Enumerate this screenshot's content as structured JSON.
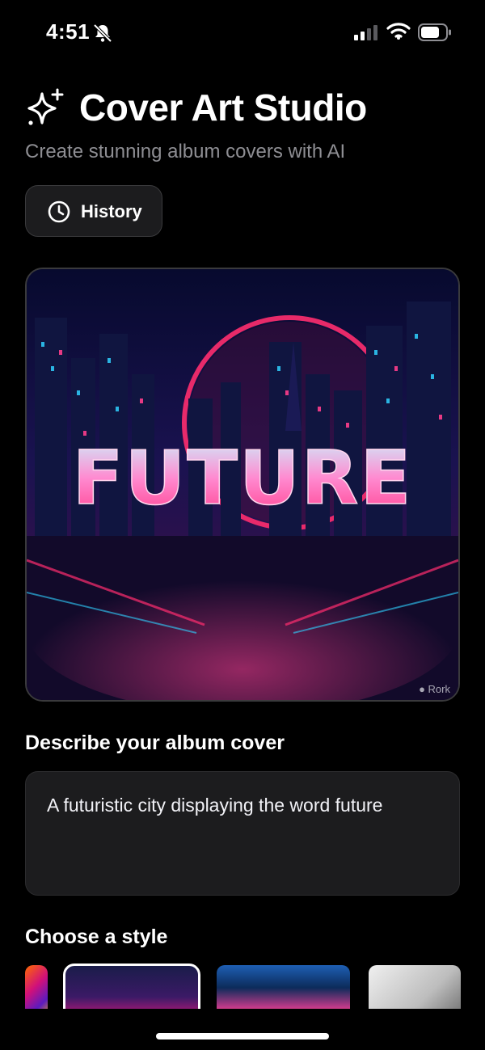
{
  "status_bar": {
    "time": "4:51"
  },
  "header": {
    "title": "Cover Art Studio",
    "subtitle": "Create stunning album covers with AI"
  },
  "history_button": {
    "label": "History",
    "icon": "clock-icon"
  },
  "cover_preview": {
    "art_text": "FUTURE",
    "watermark": "Rork"
  },
  "prompt": {
    "label": "Describe your album cover",
    "value": "A futuristic city displaying the word future"
  },
  "styles": {
    "label": "Choose a style",
    "selected_index": 1
  },
  "colors": {
    "background": "#000000",
    "surface": "#1c1c1e",
    "subtitle_text": "#8e8e93",
    "accent_pink": "#ff2d8a",
    "accent_cyan": "#2fd0ff"
  }
}
